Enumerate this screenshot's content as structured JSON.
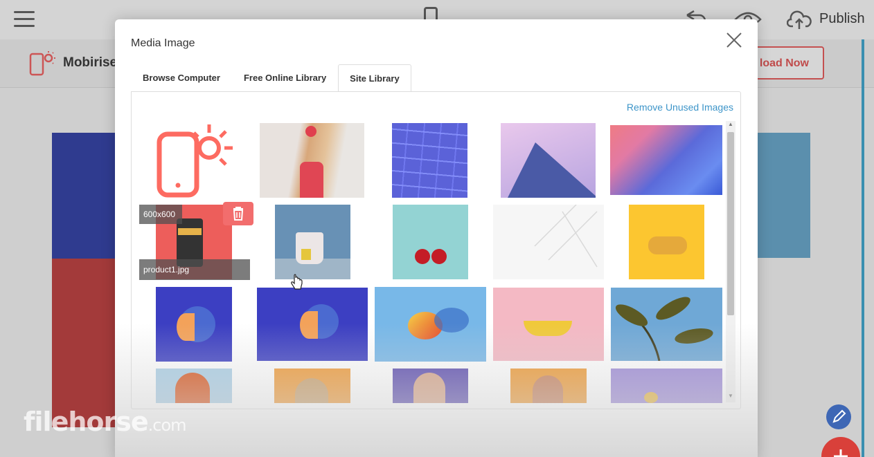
{
  "app": {
    "publish_label": "Publish",
    "brand_name": "Mobirise",
    "cta_label": "load Now",
    "watermark": "filehorse",
    "watermark_suffix": ".com"
  },
  "modal": {
    "title": "Media Image",
    "tabs": [
      {
        "label": "Browse Computer",
        "active": false
      },
      {
        "label": "Free Online Library",
        "active": false
      },
      {
        "label": "Site Library",
        "active": true
      }
    ],
    "remove_unused_label": "Remove Unused Images",
    "hover_item": {
      "size": "600x600",
      "filename": "product1.jpg"
    }
  },
  "colors": {
    "accent_link": "#3d95c9",
    "delete_button": "#f26d6d",
    "brand_red": "#fd6b61"
  },
  "icons": [
    "hamburger-icon",
    "phone-icon",
    "undo-icon",
    "eye-icon",
    "cloud-upload-icon",
    "close-icon",
    "trash-icon",
    "pencil-icon",
    "plus-icon",
    "pointer-cursor-icon"
  ]
}
